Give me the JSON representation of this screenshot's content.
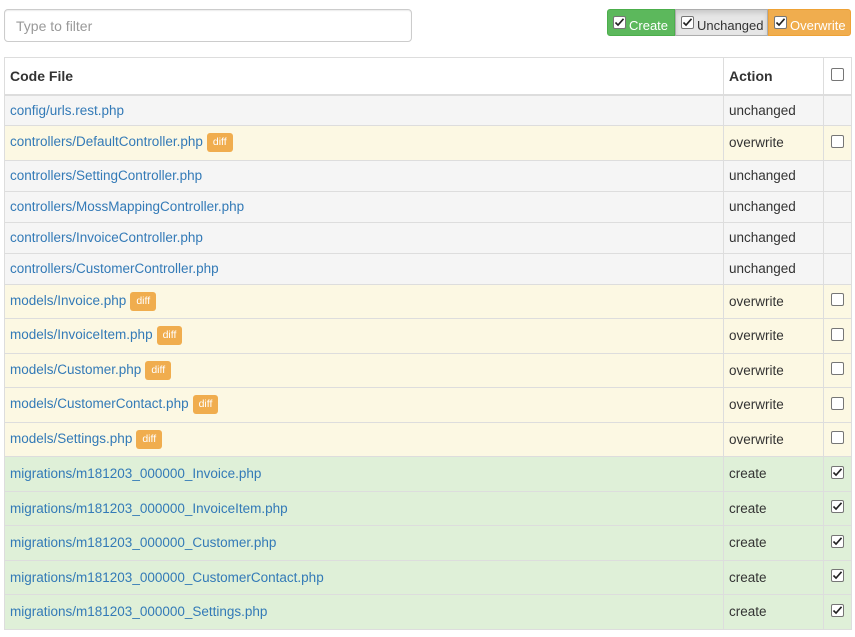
{
  "filter": {
    "placeholder": "Type to filter"
  },
  "toggles": {
    "create": {
      "label": "Create",
      "checked": true
    },
    "unchanged": {
      "label": "Unchanged",
      "checked": true
    },
    "overwrite": {
      "label": "Overwrite",
      "checked": true
    }
  },
  "table": {
    "headers": {
      "file": "Code File",
      "action": "Action"
    },
    "rows": [
      {
        "file": "config/urls.rest.php",
        "action": "unchanged",
        "diff": "",
        "checked": false,
        "type": "unchanged"
      },
      {
        "file": "controllers/DefaultController.php",
        "action": "overwrite",
        "diff": "diff",
        "checked": false,
        "type": "overwrite"
      },
      {
        "file": "controllers/SettingController.php",
        "action": "unchanged",
        "diff": "",
        "checked": false,
        "type": "unchanged"
      },
      {
        "file": "controllers/MossMappingController.php",
        "action": "unchanged",
        "diff": "",
        "checked": false,
        "type": "unchanged"
      },
      {
        "file": "controllers/InvoiceController.php",
        "action": "unchanged",
        "diff": "",
        "checked": false,
        "type": "unchanged"
      },
      {
        "file": "controllers/CustomerController.php",
        "action": "unchanged",
        "diff": "",
        "checked": false,
        "type": "unchanged"
      },
      {
        "file": "models/Invoice.php",
        "action": "overwrite",
        "diff": "diff",
        "checked": false,
        "type": "overwrite"
      },
      {
        "file": "models/InvoiceItem.php",
        "action": "overwrite",
        "diff": "diff",
        "checked": false,
        "type": "overwrite"
      },
      {
        "file": "models/Customer.php",
        "action": "overwrite",
        "diff": "diff",
        "checked": false,
        "type": "overwrite"
      },
      {
        "file": "models/CustomerContact.php",
        "action": "overwrite",
        "diff": "diff",
        "checked": false,
        "type": "overwrite"
      },
      {
        "file": "models/Settings.php",
        "action": "overwrite",
        "diff": "diff",
        "checked": false,
        "type": "overwrite"
      },
      {
        "file": "migrations/m181203_000000_Invoice.php",
        "action": "create",
        "diff": "",
        "checked": true,
        "type": "create"
      },
      {
        "file": "migrations/m181203_000000_InvoiceItem.php",
        "action": "create",
        "diff": "",
        "checked": true,
        "type": "create"
      },
      {
        "file": "migrations/m181203_000000_Customer.php",
        "action": "create",
        "diff": "",
        "checked": true,
        "type": "create"
      },
      {
        "file": "migrations/m181203_000000_CustomerContact.php",
        "action": "create",
        "diff": "",
        "checked": true,
        "type": "create"
      },
      {
        "file": "migrations/m181203_000000_Settings.php",
        "action": "create",
        "diff": "",
        "checked": true,
        "type": "create"
      }
    ]
  }
}
